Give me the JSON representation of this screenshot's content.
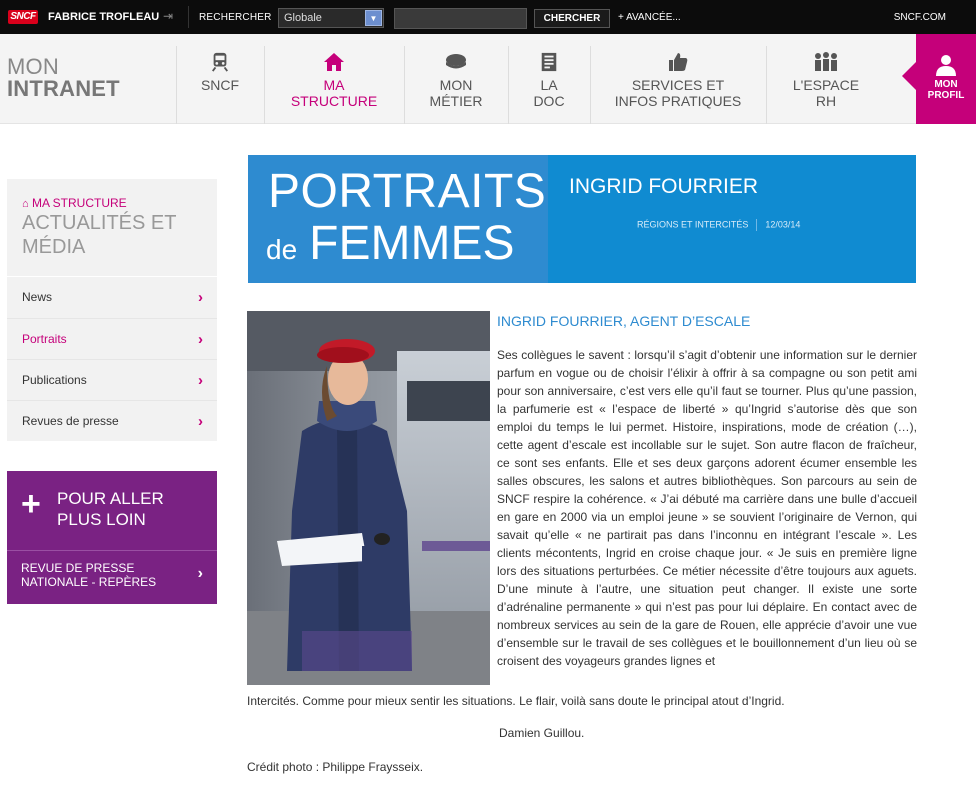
{
  "topbar": {
    "logo": "SNCF",
    "user": "FABRICE TROFLEAU",
    "search_label": "RECHERCHER",
    "scope_value": "Globale",
    "search_button": "CHERCHER",
    "advanced": "+ AVANCÉE...",
    "site_link": "SNCF.COM"
  },
  "brand": {
    "line1": "MON",
    "line2": "INTRANET"
  },
  "nav": [
    {
      "label": "SNCF",
      "icon": "train-icon"
    },
    {
      "label1": "MA",
      "label2": "STRUCTURE",
      "icon": "home-icon",
      "active": true
    },
    {
      "label1": "MON",
      "label2": "MÉTIER",
      "icon": "cap-icon"
    },
    {
      "label1": "LA",
      "label2": "DOC",
      "icon": "document-icon"
    },
    {
      "label1": "SERVICES ET",
      "label2": "INFOS PRATIQUES",
      "icon": "thumbs-up-icon"
    },
    {
      "label1": "L'ESPACE",
      "label2": "RH",
      "icon": "people-icon"
    }
  ],
  "profile": {
    "line1": "MON",
    "line2": "PROFIL"
  },
  "sidebar": {
    "crumb": "MA STRUCTURE",
    "heading_line1": "ACTUALITÉS ET",
    "heading_line2": "MÉDIA",
    "items": [
      {
        "label": "News"
      },
      {
        "label": "Portraits"
      },
      {
        "label": "Publications"
      },
      {
        "label": "Revues de presse"
      }
    ],
    "promo": {
      "title_line1": "POUR ALLER",
      "title_line2": "PLUS LOIN",
      "sub_line1": "REVUE DE PRESSE",
      "sub_line2": "NATIONALE - REPÈRES"
    }
  },
  "banner": {
    "line1": "PORTRAITS",
    "line2_small": "de",
    "line2_big": "FEMMES",
    "name": "INGRID FOURRIER",
    "category": "RÉGIONS ET INTERCITÉS",
    "date": "12/03/14"
  },
  "article": {
    "title": "INGRID FOURRIER, AGENT D’ESCALE",
    "body": "Ses collègues le savent : lorsqu’il s’agit d’obtenir une information sur le dernier parfum en vogue ou de choisir l’élixir à offrir à sa compagne ou son petit ami pour son anniversaire, c’est vers elle qu’il faut se tourner. Plus qu’une passion, la parfumerie est « l’espace de liberté » qu’Ingrid s’autorise dès que son emploi du temps le lui permet. Histoire, inspirations, mode de création (…), cette agent d’escale est incollable sur le sujet. Son autre flacon de fraîcheur, ce sont ses enfants. Elle et ses deux garçons adorent écumer ensemble les salles obscures, les salons et autres bibliothèques. Son parcours au sein de SNCF respire la cohérence. « J’ai débuté ma carrière dans une bulle d’accueil en gare en 2000 via un emploi jeune » se souvient l’originaire de Vernon, qui savait qu’elle « ne partirait pas dans l’inconnu en intégrant l’escale ». Les clients mécontents, Ingrid en croise chaque jour. « Je suis en première ligne lors des situations perturbées. Ce métier nécessite d’être toujours aux aguets. D’une minute à l’autre, une situation peut changer. Il existe une sorte d’adrénaline permanente  » qui n’est pas pour lui déplaire. En contact avec de nombreux services au sein de la gare de Rouen, elle apprécie d’avoir une vue d’ensemble sur le travail de ses collègues et le bouillonnement d’un lieu où se croisent des voyageurs grandes lignes et",
    "body_end": "Intercités. Comme pour mieux sentir les situations. Le flair, voilà sans doute le principal atout d’Ingrid.",
    "signature": "Damien Guillou.",
    "credit": "Crédit photo : Philippe Fraysseix."
  },
  "colors": {
    "accent": "#c5007a",
    "blue": "#2e8bd0",
    "purple": "#7a2283"
  }
}
